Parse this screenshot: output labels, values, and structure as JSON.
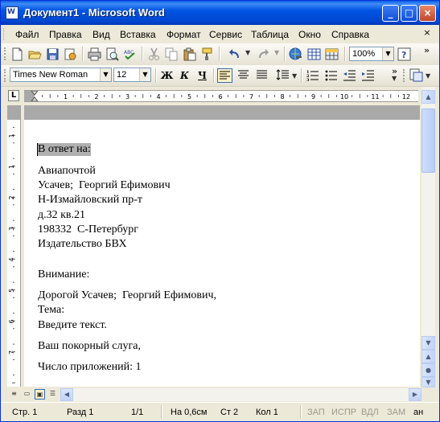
{
  "window": {
    "title": "Документ1 - Microsoft Word",
    "controls": {
      "minimize": "_",
      "maximize": "□",
      "close": "×"
    }
  },
  "menu": {
    "items": [
      "Файл",
      "Правка",
      "Вид",
      "Вставка",
      "Формат",
      "Сервис",
      "Таблица",
      "Окно",
      "Справка"
    ],
    "close_doc": "×"
  },
  "toolbar_standard": {
    "zoom": "100%"
  },
  "toolbar_format": {
    "font": "Times New Roman",
    "size": "12",
    "bold": "Ж",
    "italic": "К",
    "underline": "Ч"
  },
  "ruler": {
    "tab_selector": "L",
    "numbers": [
      "1",
      "2",
      "3",
      "4",
      "5",
      "6",
      "7",
      "8",
      "9",
      "10",
      "11",
      "12"
    ]
  },
  "document": {
    "lines": [
      "В ответ на:",
      "Авиапочтой",
      "Усачев;  Георгий Ефимович",
      "Н-Измайловский пр-т",
      "д.32 кв.21",
      "198332  С-Петербург",
      "Издательство БВХ",
      "Внимание:",
      "Дорогой Усачев;  Георгий Ефимович,",
      "Тема:",
      "Введите текст.",
      "Ваш покорный слуга,",
      "Число приложений: 1"
    ]
  },
  "statusbar": {
    "page": "Стр. 1",
    "section": "Разд 1",
    "pages": "1/1",
    "at": "На 0,6см",
    "line": "Ст 2",
    "col": "Кол 1",
    "rec": "ЗАП",
    "trk": "ИСПР",
    "ext": "ВДЛ",
    "ovr": "ЗАМ",
    "lang": "ан"
  }
}
